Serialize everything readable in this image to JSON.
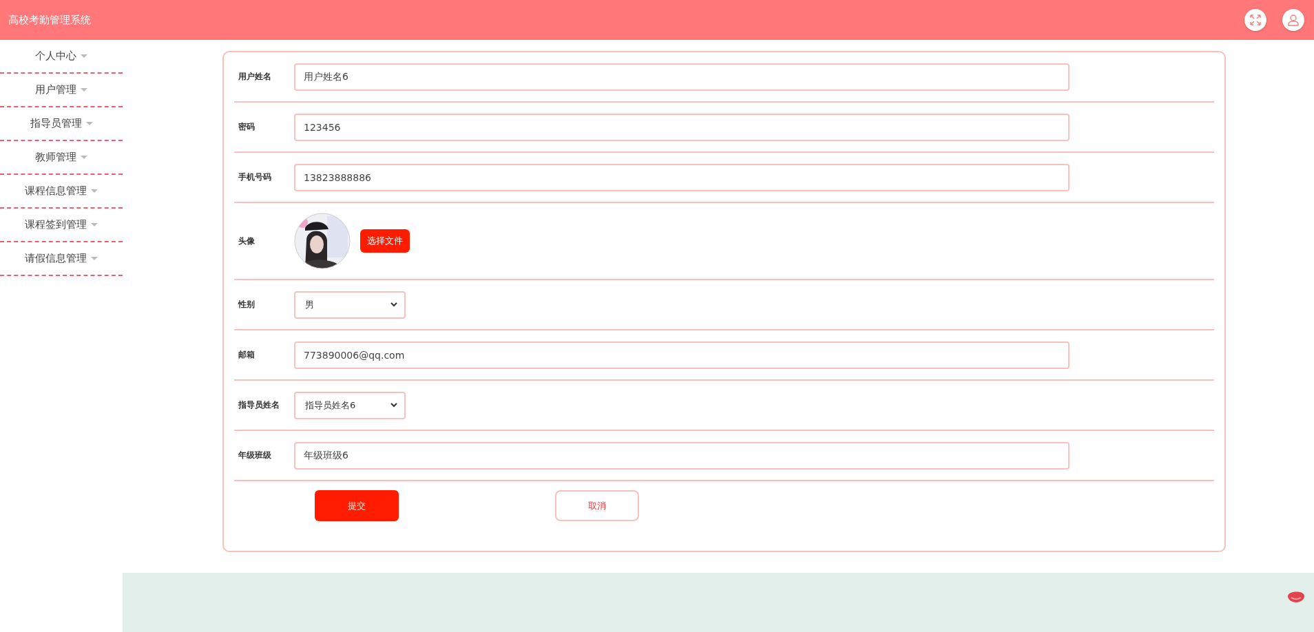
{
  "header": {
    "title": "高校考勤管理系统"
  },
  "sidebar": {
    "items": [
      {
        "label": "个人中心"
      },
      {
        "label": "用户管理"
      },
      {
        "label": "指导员管理"
      },
      {
        "label": "教师管理"
      },
      {
        "label": "课程信息管理"
      },
      {
        "label": "课程签到管理"
      },
      {
        "label": "请假信息管理"
      }
    ]
  },
  "form": {
    "fields": [
      {
        "kind": "text",
        "label": "用户姓名",
        "value": "用户姓名6"
      },
      {
        "kind": "text",
        "label": "密码",
        "value": "123456"
      },
      {
        "kind": "text",
        "label": "手机号码",
        "value": "13823888886"
      },
      {
        "label": "头像",
        "button": "选择文件"
      },
      {
        "kind": "select",
        "label": "性别",
        "value": "男"
      },
      {
        "kind": "text",
        "label": "邮箱",
        "value": "773890006@qq.com"
      },
      {
        "kind": "select",
        "label": "指导员姓名",
        "value": "指导员姓名6"
      },
      {
        "kind": "text",
        "label": "年级班级",
        "value": "年级班级6"
      }
    ],
    "submit": "提交",
    "cancel": "取消"
  }
}
